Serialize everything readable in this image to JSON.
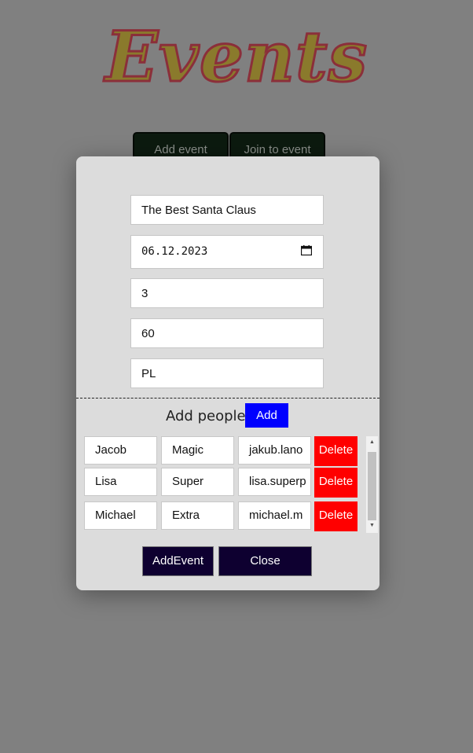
{
  "page": {
    "title": "Events"
  },
  "header": {
    "add_event_label": "Add event",
    "join_event_label": "Join to event"
  },
  "modal": {
    "fields": {
      "event_name": "The Best Santa Claus",
      "date": "06.12.2023",
      "field_3": "3",
      "field_4": "60",
      "field_5": "PL"
    },
    "add_people_label": "Add people",
    "add_button_label": "Add",
    "people": [
      {
        "first": "Jacob",
        "last": "Magic",
        "email": "jakub.lano",
        "delete": "Delete"
      },
      {
        "first": "Lisa",
        "last": "Super",
        "email": "lisa.superp",
        "delete": "Delete"
      },
      {
        "first": "Michael",
        "last": "Extra",
        "email": "michael.m",
        "delete": "Delete"
      }
    ],
    "add_event_button": "AddEvent",
    "close_button": "Close"
  },
  "colors": {
    "background": "#808080",
    "modal": "#dcdcdc",
    "add_blue": "#0000ff",
    "delete_red": "#ff0000",
    "footer_button": "#0e0030",
    "title_fill": "#8a7a2c",
    "title_stroke": "#8b2f3a"
  },
  "icons": {
    "date_picker": "calendar-icon",
    "scroll_up": "arrow-up-icon",
    "scroll_down": "arrow-down-icon"
  }
}
